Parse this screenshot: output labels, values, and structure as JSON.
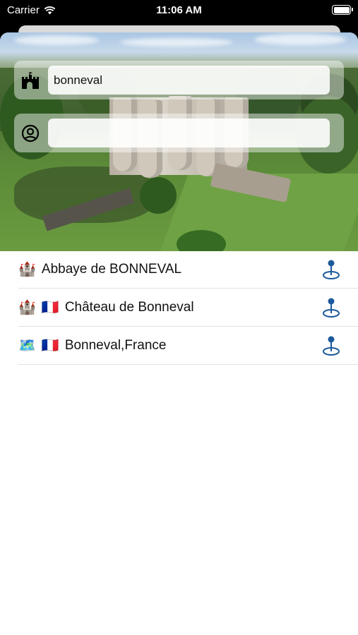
{
  "status_bar": {
    "carrier": "Carrier",
    "time": "11:06 AM",
    "battery_level": 1.0,
    "icons": [
      "wifi-icon",
      "battery-icon"
    ]
  },
  "search": {
    "place_icon": "castle-icon",
    "place_value": "bonneval",
    "place_placeholder": "",
    "person_icon": "person-circle-icon",
    "person_value": "",
    "person_placeholder": ""
  },
  "results": [
    {
      "icon": "castle-icon",
      "icon_glyph": "🏰",
      "flag": "",
      "label": "Abbaye de BONNEVAL",
      "action_icon": "map-pin-icon"
    },
    {
      "icon": "castle-icon",
      "icon_glyph": "🏰",
      "flag": "🇫🇷",
      "label": "Château de Bonneval",
      "action_icon": "map-pin-icon"
    },
    {
      "icon": "map-icon",
      "icon_glyph": "🗺️",
      "flag": "🇫🇷",
      "label": "Bonneval,France",
      "action_icon": "map-pin-icon"
    }
  ],
  "colors": {
    "pin": "#1c5a9c",
    "divider": "#e0e0e0"
  }
}
